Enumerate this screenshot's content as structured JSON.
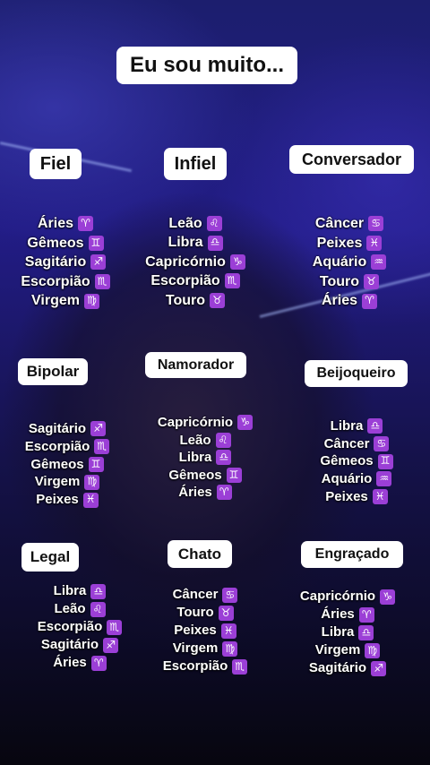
{
  "title": "Eu sou muito...",
  "colors": {
    "symbol_bg": "#9b3fd6",
    "label_bg": "#ffffff"
  },
  "categories": [
    {
      "key": "fiel",
      "label": "Fiel",
      "signs": [
        {
          "name": "Áries",
          "symbol": "♈"
        },
        {
          "name": "Gêmeos",
          "symbol": "♊"
        },
        {
          "name": "Sagitário",
          "symbol": "♐"
        },
        {
          "name": "Escorpião",
          "symbol": "♏"
        },
        {
          "name": "Virgem",
          "symbol": "♍"
        }
      ]
    },
    {
      "key": "infiel",
      "label": "Infiel",
      "signs": [
        {
          "name": "Leão",
          "symbol": "♌"
        },
        {
          "name": "Libra",
          "symbol": "♎"
        },
        {
          "name": "Capricórnio",
          "symbol": "♑"
        },
        {
          "name": "Escorpião",
          "symbol": "♏"
        },
        {
          "name": "Touro",
          "symbol": "♉"
        }
      ]
    },
    {
      "key": "conversador",
      "label": "Conversador",
      "signs": [
        {
          "name": "Câncer",
          "symbol": "♋"
        },
        {
          "name": "Peixes",
          "symbol": "♓"
        },
        {
          "name": "Aquário",
          "symbol": "♒"
        },
        {
          "name": "Touro",
          "symbol": "♉"
        },
        {
          "name": "Áries",
          "symbol": "♈"
        }
      ]
    },
    {
      "key": "bipolar",
      "label": "Bipolar",
      "signs": [
        {
          "name": "Sagitário",
          "symbol": "♐"
        },
        {
          "name": "Escorpião",
          "symbol": "♏"
        },
        {
          "name": "Gêmeos",
          "symbol": "♊"
        },
        {
          "name": "Virgem",
          "symbol": "♍"
        },
        {
          "name": "Peixes",
          "symbol": "♓"
        }
      ]
    },
    {
      "key": "namorador",
      "label": "Namorador",
      "signs": [
        {
          "name": "Capricórnio",
          "symbol": "♑"
        },
        {
          "name": "Leão",
          "symbol": "♌"
        },
        {
          "name": "Libra",
          "symbol": "♎"
        },
        {
          "name": "Gêmeos",
          "symbol": "♊"
        },
        {
          "name": "Áries",
          "symbol": "♈"
        }
      ]
    },
    {
      "key": "beijoqueiro",
      "label": "Beijoqueiro",
      "signs": [
        {
          "name": "Libra",
          "symbol": "♎"
        },
        {
          "name": "Câncer",
          "symbol": "♋"
        },
        {
          "name": "Gêmeos",
          "symbol": "♊"
        },
        {
          "name": "Aquário",
          "symbol": "♒"
        },
        {
          "name": "Peixes",
          "symbol": "♓"
        }
      ]
    },
    {
      "key": "legal",
      "label": "Legal",
      "signs": [
        {
          "name": "Libra",
          "symbol": "♎"
        },
        {
          "name": "Leão",
          "symbol": "♌"
        },
        {
          "name": "Escorpião",
          "symbol": "♏"
        },
        {
          "name": "Sagitário",
          "symbol": "♐"
        },
        {
          "name": "Áries",
          "symbol": "♈"
        }
      ]
    },
    {
      "key": "chato",
      "label": "Chato",
      "signs": [
        {
          "name": "Câncer",
          "symbol": "♋"
        },
        {
          "name": "Touro",
          "symbol": "♉"
        },
        {
          "name": "Peixes",
          "symbol": "♓"
        },
        {
          "name": "Virgem",
          "symbol": "♍"
        },
        {
          "name": "Escorpião",
          "symbol": "♏"
        }
      ]
    },
    {
      "key": "engracado",
      "label": "Engraçado",
      "signs": [
        {
          "name": "Capricórnio",
          "symbol": "♑"
        },
        {
          "name": "Áries",
          "symbol": "♈"
        },
        {
          "name": "Libra",
          "symbol": "♎"
        },
        {
          "name": "Virgem",
          "symbol": "♍"
        },
        {
          "name": "Sagitário",
          "symbol": "♐"
        }
      ]
    }
  ]
}
